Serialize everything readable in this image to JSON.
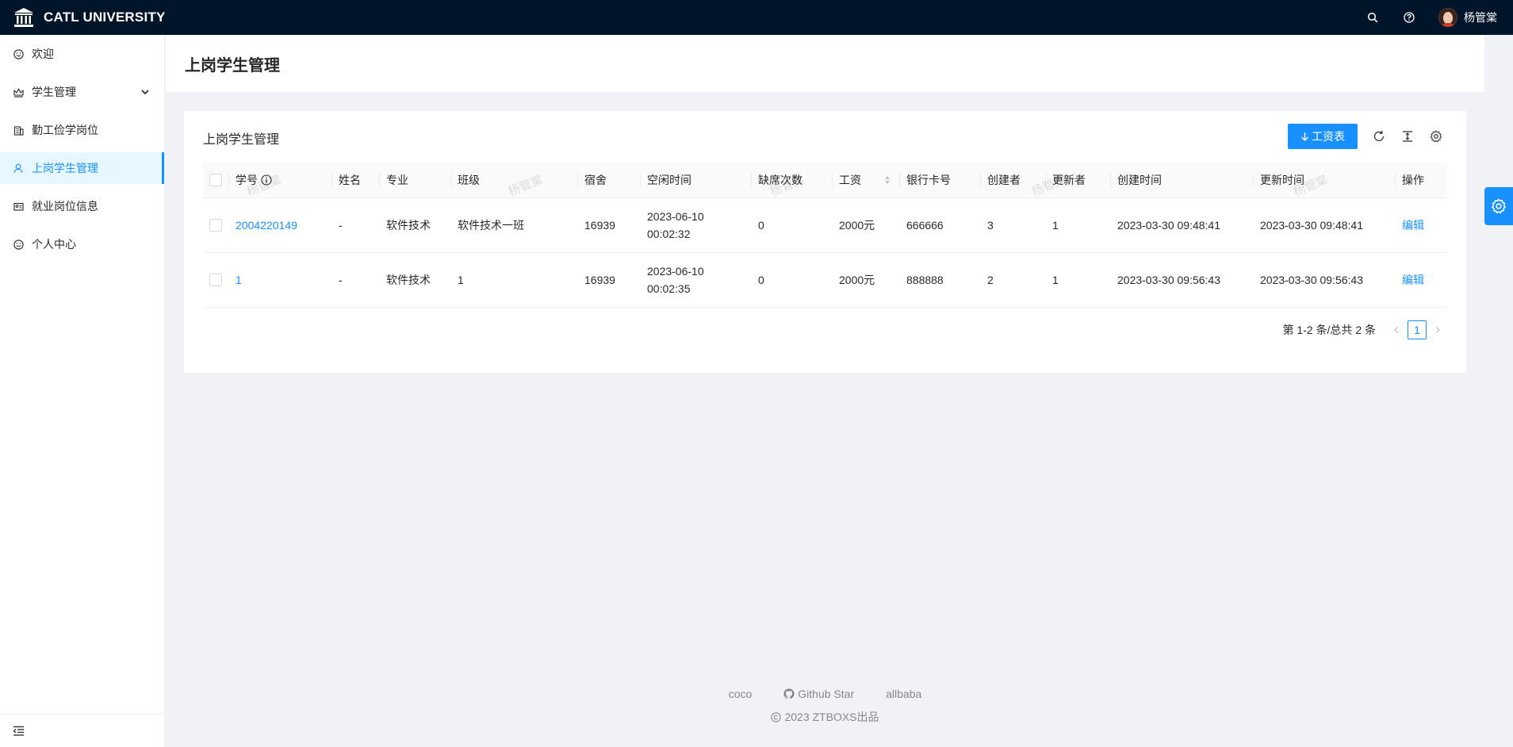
{
  "app": {
    "name": "CATL UNIVERSITY",
    "user": "杨管棠"
  },
  "sidebar": {
    "items": [
      {
        "label": "欢迎",
        "icon": "smile-icon"
      },
      {
        "label": "学生管理",
        "icon": "crown-icon"
      },
      {
        "label": "勤工俭学岗位",
        "icon": "building-icon"
      },
      {
        "label": "上岗学生管理",
        "icon": "user-icon"
      },
      {
        "label": "就业岗位信息",
        "icon": "id-card-icon"
      },
      {
        "label": "个人中心",
        "icon": "smile-icon"
      }
    ],
    "active_index": 3
  },
  "page": {
    "title": "上岗学生管理"
  },
  "card": {
    "title": "上岗学生管理",
    "export_button": "工资表"
  },
  "table": {
    "columns": [
      "学号",
      "姓名",
      "专业",
      "班级",
      "宿舍",
      "空闲时间",
      "缺席次数",
      "工资",
      "银行卡号",
      "创建者",
      "更新者",
      "创建时间",
      "更新时间",
      "操作"
    ],
    "rows": [
      {
        "id": "2004220149",
        "name": "-",
        "major": "软件技术",
        "class": "软件技术一班",
        "dorm": "16939",
        "idle_date": "2023-06-10",
        "idle_time": "00:02:32",
        "absent": "0",
        "salary": "2000元",
        "bank": "666666",
        "creator": "3",
        "updater": "1",
        "created": "2023-03-30 09:48:41",
        "updated": "2023-03-30 09:48:41",
        "action": "编辑"
      },
      {
        "id": "1",
        "name": "-",
        "major": "软件技术",
        "class": "1",
        "dorm": "16939",
        "idle_date": "2023-06-10",
        "idle_time": "00:02:35",
        "absent": "0",
        "salary": "2000元",
        "bank": "888888",
        "creator": "2",
        "updater": "1",
        "created": "2023-03-30 09:56:43",
        "updated": "2023-03-30 09:56:43",
        "action": "编辑"
      }
    ]
  },
  "pagination": {
    "total_text": "第 1-2 条/总共 2 条",
    "current": "1"
  },
  "watermark": "杨管棠",
  "footer": {
    "links": [
      "coco",
      "Github Star",
      "allbaba"
    ],
    "copyright": "2023 ZTBOXS出品"
  },
  "colors": {
    "header_bg": "#001529",
    "primary": "#1890ff",
    "active_bg": "#e6f7ff",
    "page_bg": "#f0f2f5"
  }
}
